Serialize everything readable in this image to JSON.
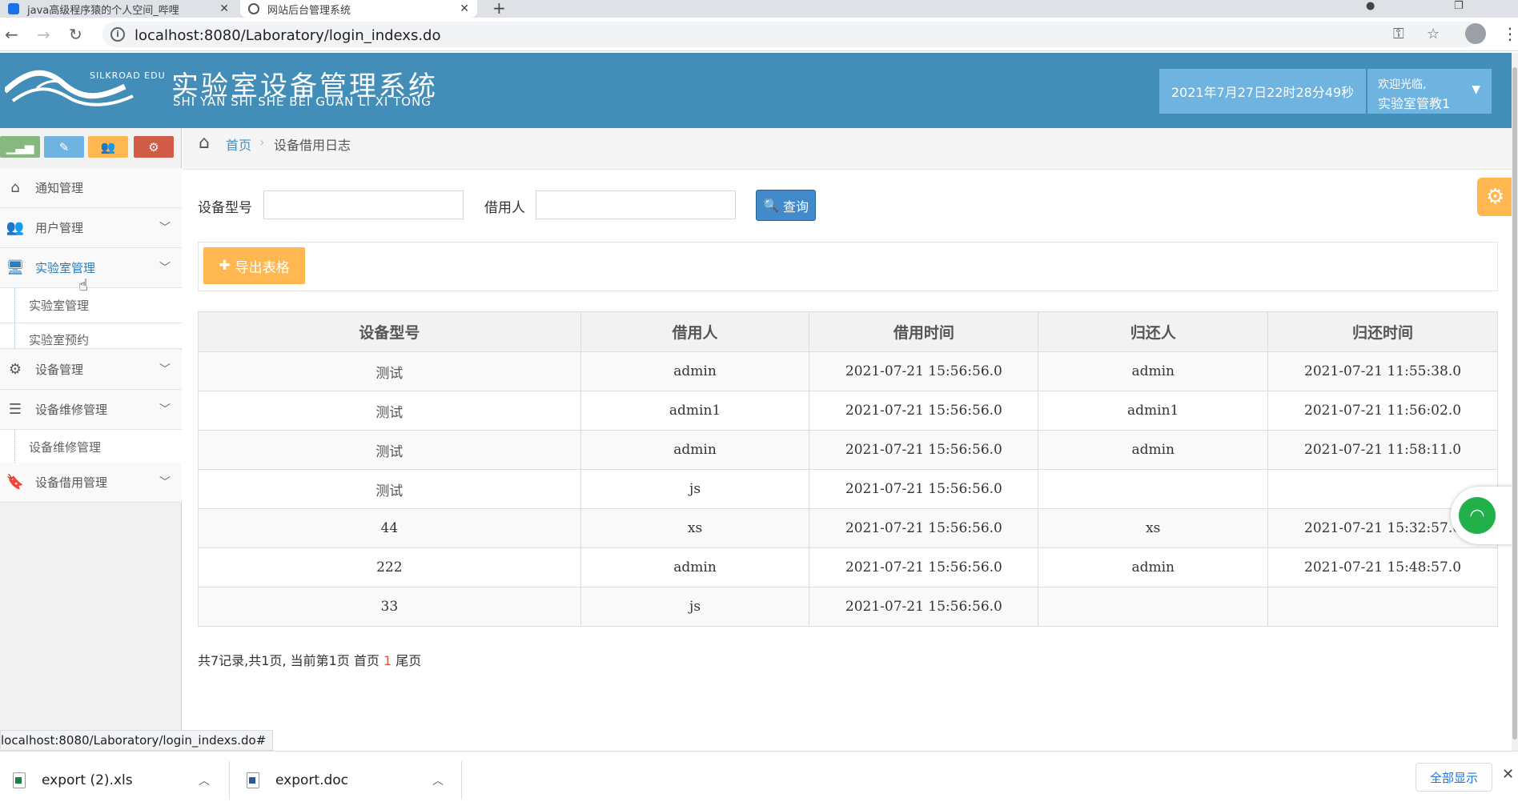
{
  "browser": {
    "tabs": [
      {
        "title": "java高级程序猿的个人空间_哔哩"
      },
      {
        "title": "网站后台管理系统"
      }
    ],
    "url": "localhost:8080/Laboratory/login_indexs.do"
  },
  "header": {
    "logo_text": "SILKROAD EDU",
    "title": "实验室设备管理系统",
    "subtitle": "SHI YAN SHI SHE BEI GUAN LI XI TONG",
    "datetime": "2021年7月27日22时28分49秒",
    "welcome": "欢迎光临,",
    "username": "实验室管教1"
  },
  "sidebar": {
    "shortcut_colors": [
      "#87b87f",
      "#6fb3e0",
      "#ffb752",
      "#d15b47"
    ],
    "menu": [
      {
        "label": "通知管理",
        "icon": "home-icon"
      },
      {
        "label": "用户管理",
        "icon": "users-icon"
      },
      {
        "label": "实验室管理",
        "icon": "desktop-icon"
      },
      {
        "label": "设备管理",
        "icon": "cogs-icon"
      },
      {
        "label": "设备维修管理",
        "icon": "list-icon"
      },
      {
        "label": "设备借用管理",
        "icon": "bookmark-icon"
      }
    ],
    "lab_sub": [
      "实验室管理",
      "实验室预约"
    ],
    "repair_sub": [
      "设备维修管理"
    ]
  },
  "breadcrumb": {
    "home": "首页",
    "current": "设备借用日志"
  },
  "search": {
    "model_label": "设备型号",
    "model_value": "",
    "borrower_label": "借用人",
    "borrower_value": "",
    "query_button": "查询"
  },
  "export_button": "导出表格",
  "table": {
    "headers": [
      "设备型号",
      "借用人",
      "借用时间",
      "归还人",
      "归还时间"
    ],
    "rows": [
      [
        "测试",
        "admin",
        "2021-07-21 15:56:56.0",
        "admin",
        "2021-07-21 11:55:38.0"
      ],
      [
        "测试",
        "admin1",
        "2021-07-21 15:56:56.0",
        "admin1",
        "2021-07-21 11:56:02.0"
      ],
      [
        "测试",
        "admin",
        "2021-07-21 15:56:56.0",
        "admin",
        "2021-07-21 11:58:11.0"
      ],
      [
        "测试",
        "js",
        "2021-07-21 15:56:56.0",
        "",
        ""
      ],
      [
        "44",
        "xs",
        "2021-07-21 15:56:56.0",
        "xs",
        "2021-07-21 15:32:57.0"
      ],
      [
        "222",
        "admin",
        "2021-07-21 15:56:56.0",
        "admin",
        "2021-07-21 15:48:57.0"
      ],
      [
        "33",
        "js",
        "2021-07-21 15:56:56.0",
        "",
        ""
      ]
    ]
  },
  "pager": {
    "summary": "共7记录,共1页, 当前第1页",
    "first": "首页",
    "current": "1",
    "last": "尾页"
  },
  "status_url": "localhost:8080/Laboratory/login_indexs.do#",
  "downloads": [
    {
      "name": "export (2).xls"
    },
    {
      "name": "export.doc"
    }
  ],
  "show_all": "全部显示"
}
